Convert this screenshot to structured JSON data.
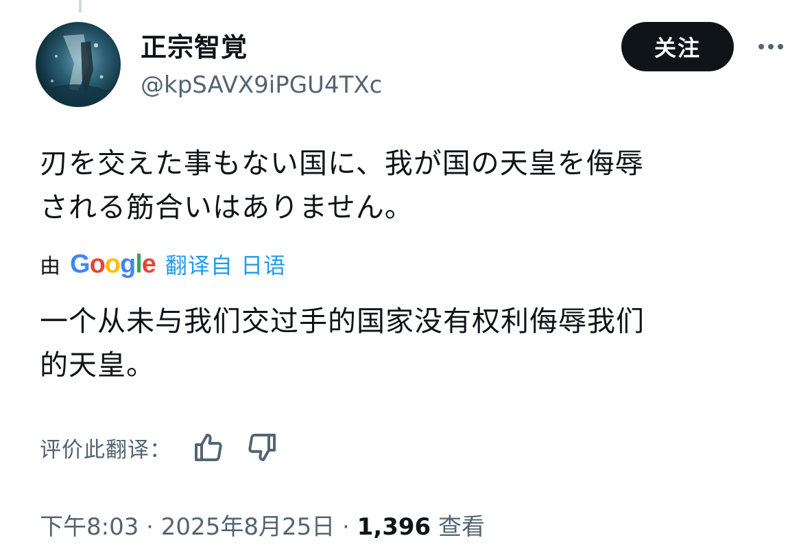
{
  "author": {
    "display_name": "正宗智覚",
    "handle": "@kpSAVX9iPGU4TXc"
  },
  "actions": {
    "follow_label": "关注",
    "more_icon": "more-horizontal-icon"
  },
  "tweet": {
    "text_line1": "刃を交えた事もない国に、我が国の天皇を侮辱",
    "text_line2": "される筋合いはありません。"
  },
  "translation": {
    "by_label": "由",
    "provider": "Google",
    "translated_from": "翻译自 日语",
    "text_line1": "一个从未与我们交过手的国家没有权利侮辱我们",
    "text_line2": "的天皇。",
    "rate_label": "评价此翻译：",
    "thumbs_up_icon": "thumbs-up-icon",
    "thumbs_down_icon": "thumbs-down-icon"
  },
  "meta": {
    "time": "下午8:03",
    "date": "2025年8月25日",
    "separator": "·",
    "views_count": "1,396",
    "views_label": "查看"
  },
  "colors": {
    "text_primary": "#0f1419",
    "text_secondary": "#536471",
    "link_blue": "#1d9bf0",
    "follow_bg": "#0f1419"
  }
}
